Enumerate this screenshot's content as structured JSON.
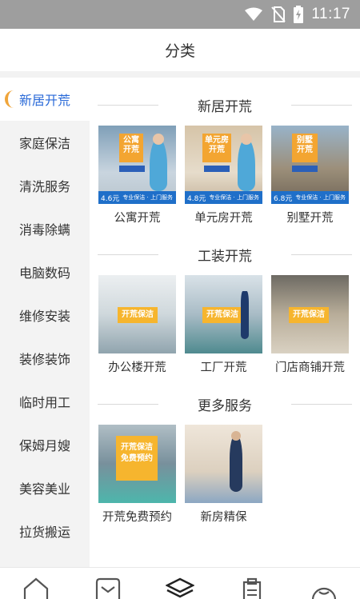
{
  "status_bar": {
    "time": "11:17"
  },
  "header": {
    "title": "分类"
  },
  "sidebar": {
    "items": [
      {
        "label": "新居开荒",
        "active": true
      },
      {
        "label": "家庭保洁",
        "active": false
      },
      {
        "label": "清洗服务",
        "active": false
      },
      {
        "label": "消毒除螨",
        "active": false
      },
      {
        "label": "电脑数码",
        "active": false
      },
      {
        "label": "维修安装",
        "active": false
      },
      {
        "label": "装修装饰",
        "active": false
      },
      {
        "label": "临时用工",
        "active": false
      },
      {
        "label": "保姆月嫂",
        "active": false
      },
      {
        "label": "美容美业",
        "active": false
      },
      {
        "label": "拉货搬运",
        "active": false
      }
    ]
  },
  "sections": [
    {
      "title": "新居开荒",
      "tiles": [
        {
          "label": "公寓开荒",
          "badge": "公寓\n开荒",
          "price": "4.6元",
          "tag": "专业保洁 · 上门服务"
        },
        {
          "label": "单元房开荒",
          "badge": "单元房\n开荒",
          "price": "4.8元",
          "tag": "专业保洁 · 上门服务"
        },
        {
          "label": "别墅开荒",
          "badge": "别墅\n开荒",
          "price": "6.8元",
          "tag": "专业保洁 · 上门服务"
        }
      ]
    },
    {
      "title": "工装开荒",
      "tiles": [
        {
          "label": "办公楼开荒",
          "badge": "开荒保洁"
        },
        {
          "label": "工厂开荒",
          "badge": "开荒保洁"
        },
        {
          "label": "门店商铺开荒",
          "badge": "开荒保洁"
        }
      ]
    },
    {
      "title": "更多服务",
      "tiles": [
        {
          "label": "开荒免费预约",
          "badge": "开荒保洁\n免费预约"
        },
        {
          "label": "新房精保"
        }
      ]
    }
  ],
  "colors": {
    "accent_blue": "#2a6ad8",
    "marker_orange": "#f0a53a",
    "badge_orange": "#f3a531",
    "strip_blue": "#1f6fc9"
  },
  "tab_icons": [
    "home-icon",
    "mail-icon",
    "layers-icon",
    "clipboard-icon",
    "smile-icon"
  ]
}
